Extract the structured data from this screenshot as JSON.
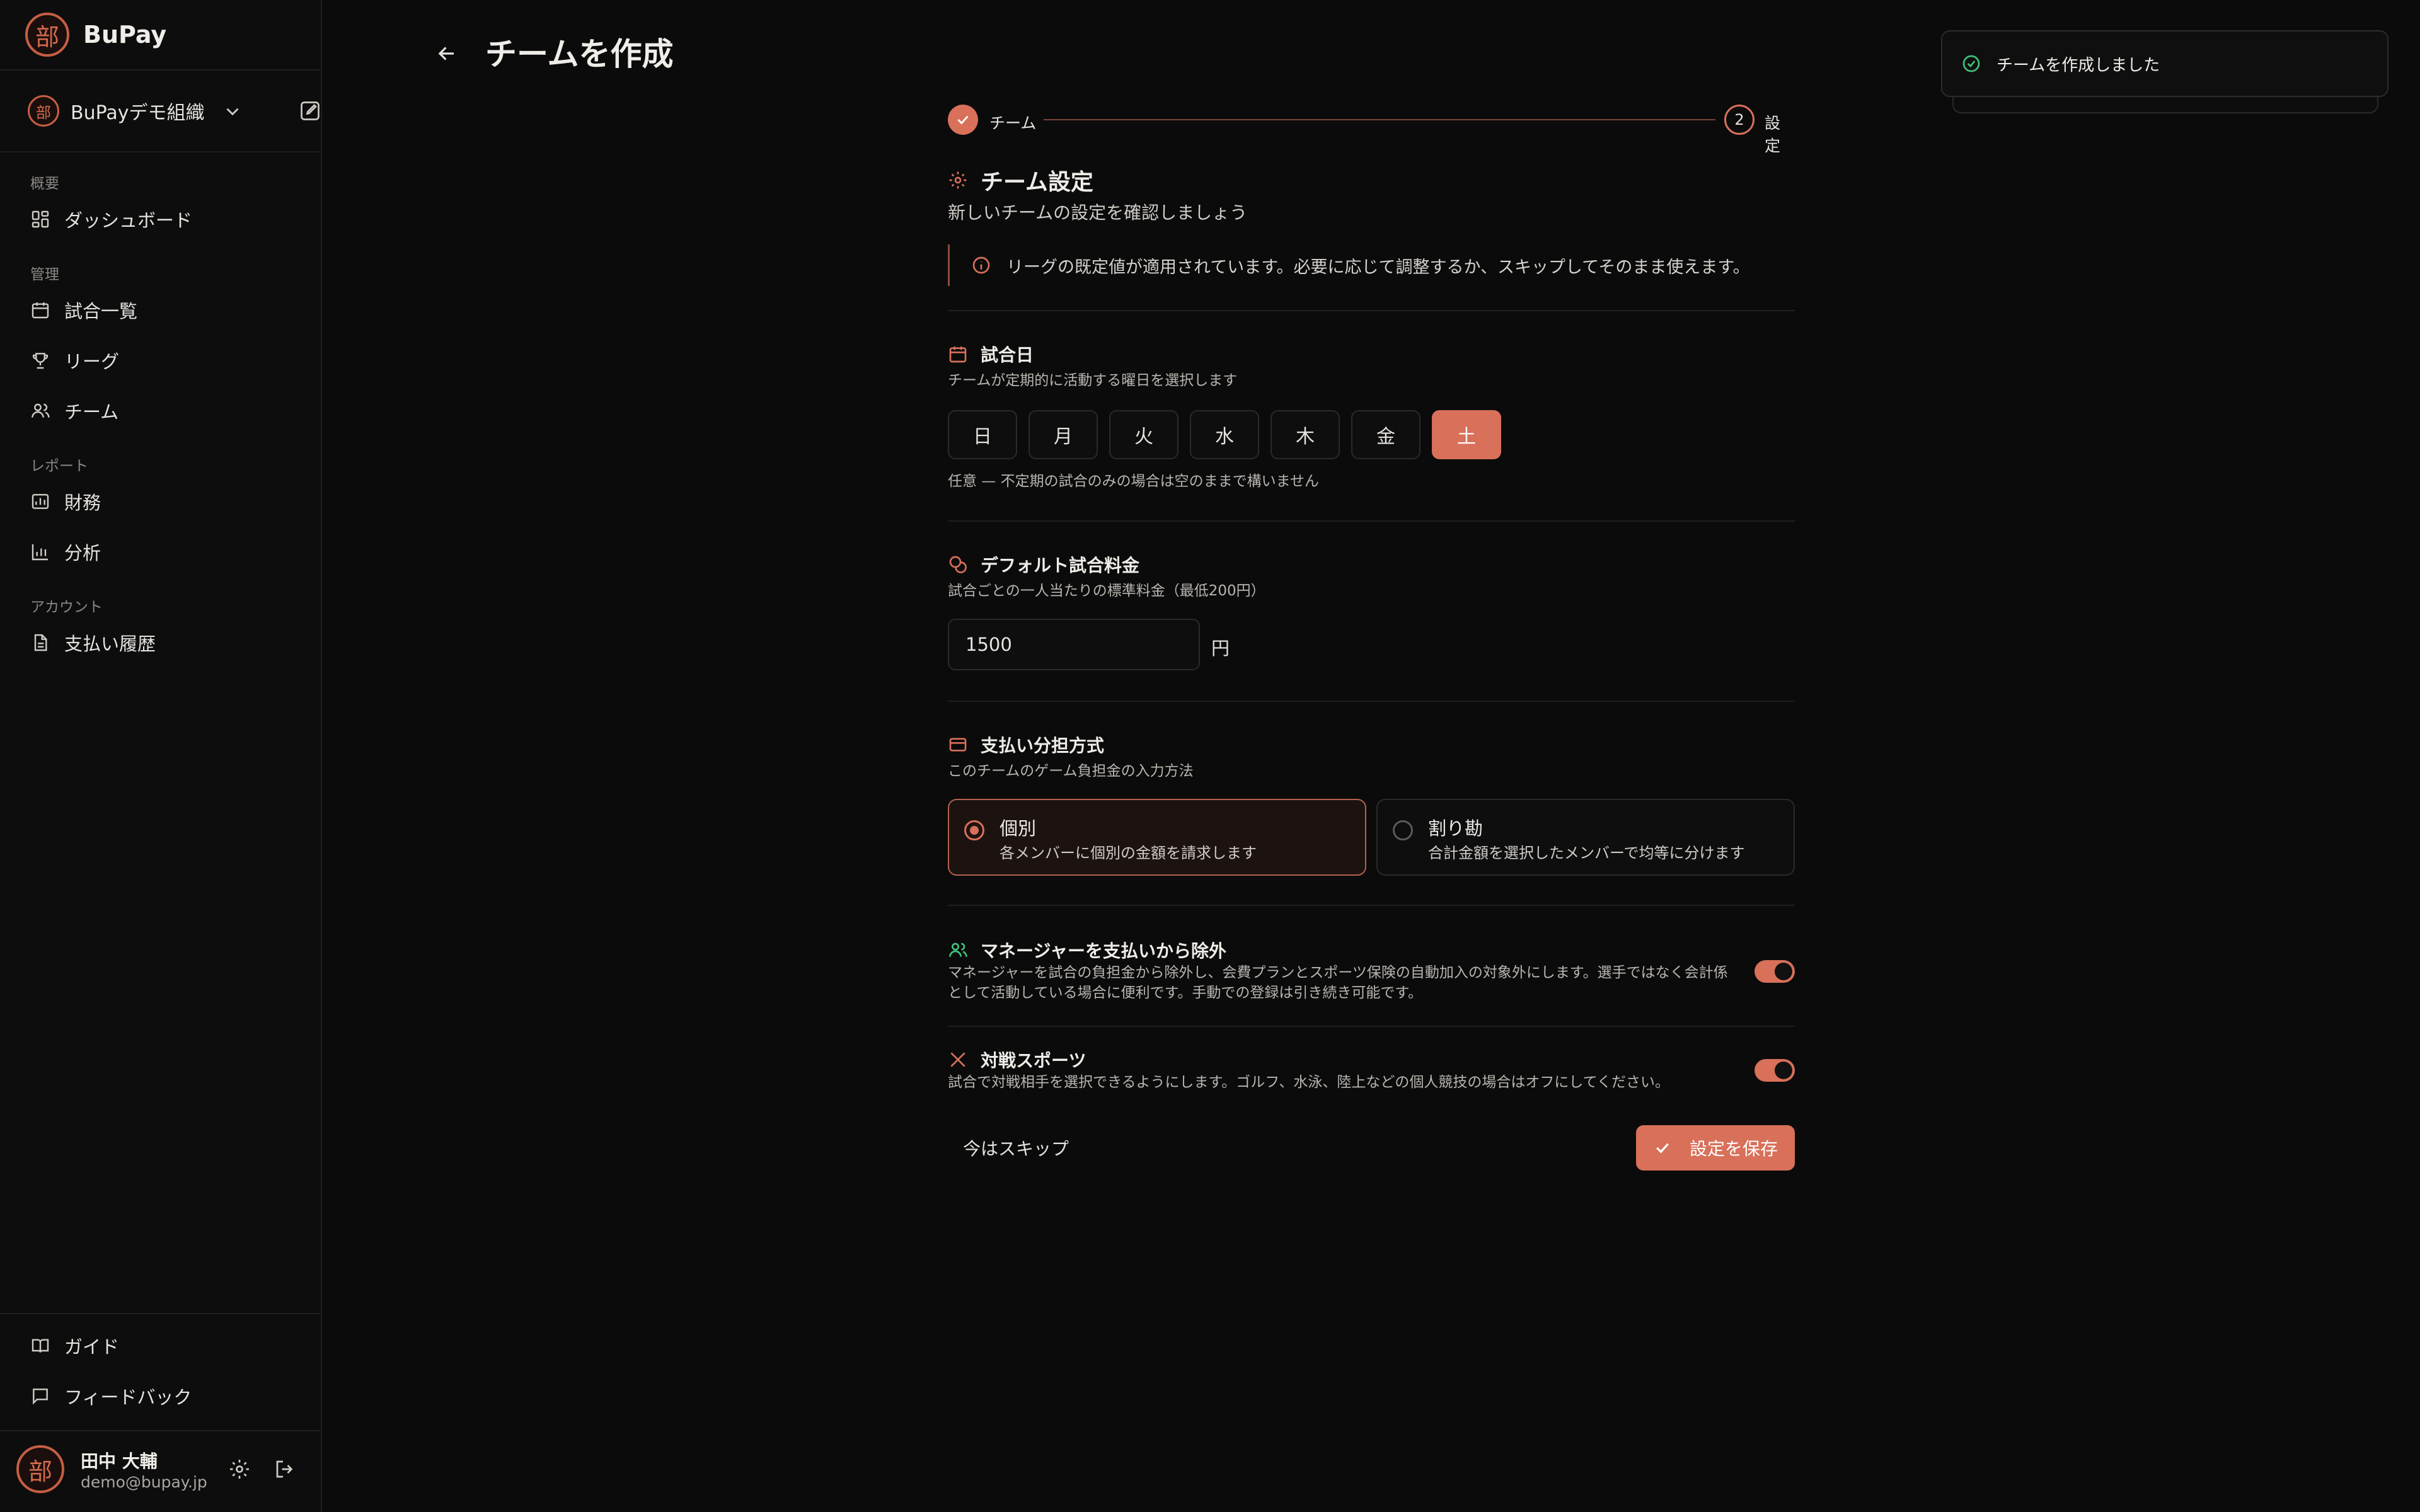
{
  "app": {
    "name": "BuPay",
    "logo_char": "部"
  },
  "org": {
    "name": "BuPayデモ組織",
    "logo_char": "部"
  },
  "nav": {
    "sections": [
      {
        "label": "概要"
      },
      {
        "label": "管理"
      },
      {
        "label": "レポート"
      },
      {
        "label": "アカウント"
      }
    ],
    "items": [
      {
        "label": "ダッシュボード",
        "icon": "dashboard-icon"
      },
      {
        "label": "試合一覧",
        "icon": "calendar-icon"
      },
      {
        "label": "リーグ",
        "icon": "trophy-icon"
      },
      {
        "label": "チーム",
        "icon": "users-icon"
      },
      {
        "label": "財務",
        "icon": "finance-chart-icon"
      },
      {
        "label": "分析",
        "icon": "bar-chart-icon"
      },
      {
        "label": "支払い履歴",
        "icon": "document-icon"
      }
    ],
    "footer": [
      {
        "label": "ガイド",
        "icon": "book-icon"
      },
      {
        "label": "フィードバック",
        "icon": "message-icon"
      }
    ]
  },
  "user": {
    "name": "田中 大輔",
    "email": "demo@bupay.jp",
    "avatar_char": "部"
  },
  "header": {
    "title": "チームを作成"
  },
  "toast": {
    "message": "チームを作成しました"
  },
  "stepper": {
    "steps": [
      {
        "label": "チーム",
        "state": "done"
      },
      {
        "label": "設定",
        "number": "2",
        "state": "current"
      }
    ]
  },
  "settings": {
    "title": "チーム設定",
    "subtitle": "新しいチームの設定を確認しましょう",
    "notice": "リーグの既定値が適用されています。必要に応じて調整するか、スキップしてそのまま使えます。",
    "match_days": {
      "title": "試合日",
      "description": "チームが定期的に活動する曜日を選択します",
      "days": [
        "日",
        "月",
        "火",
        "水",
        "木",
        "金",
        "土"
      ],
      "selected": "土",
      "hint": "任意 — 不定期の試合のみの場合は空のままで構いません"
    },
    "fee": {
      "title": "デフォルト試合料金",
      "description": "試合ごとの一人当たりの標準料金（最低200円）",
      "value": "1500",
      "unit": "円"
    },
    "split": {
      "title": "支払い分担方式",
      "description": "このチームのゲーム負担金の入力方法",
      "options": [
        {
          "title": "個別",
          "description": "各メンバーに個別の金額を請求します",
          "selected": true
        },
        {
          "title": "割り勘",
          "description": "合計金額を選択したメンバーで均等に分けます",
          "selected": false
        }
      ]
    },
    "exclude_manager": {
      "title": "マネージャーを支払いから除外",
      "description": "マネージャーを試合の負担金から除外し、会費プランとスポーツ保険の自動加入の対象外にします。選手ではなく会計係として活動している場合に便利です。手動での登録は引き続き可能です。",
      "enabled": true
    },
    "competitive": {
      "title": "対戦スポーツ",
      "description": "試合で対戦相手を選択できるようにします。ゴルフ、水泳、陸上などの個人競技の場合はオフにしてください。",
      "enabled": true
    },
    "skip_label": "今はスキップ",
    "save_label": "設定を保存"
  },
  "colors": {
    "accent": "#d8705a",
    "background": "#0b0b0b",
    "success": "#3ec27a"
  }
}
